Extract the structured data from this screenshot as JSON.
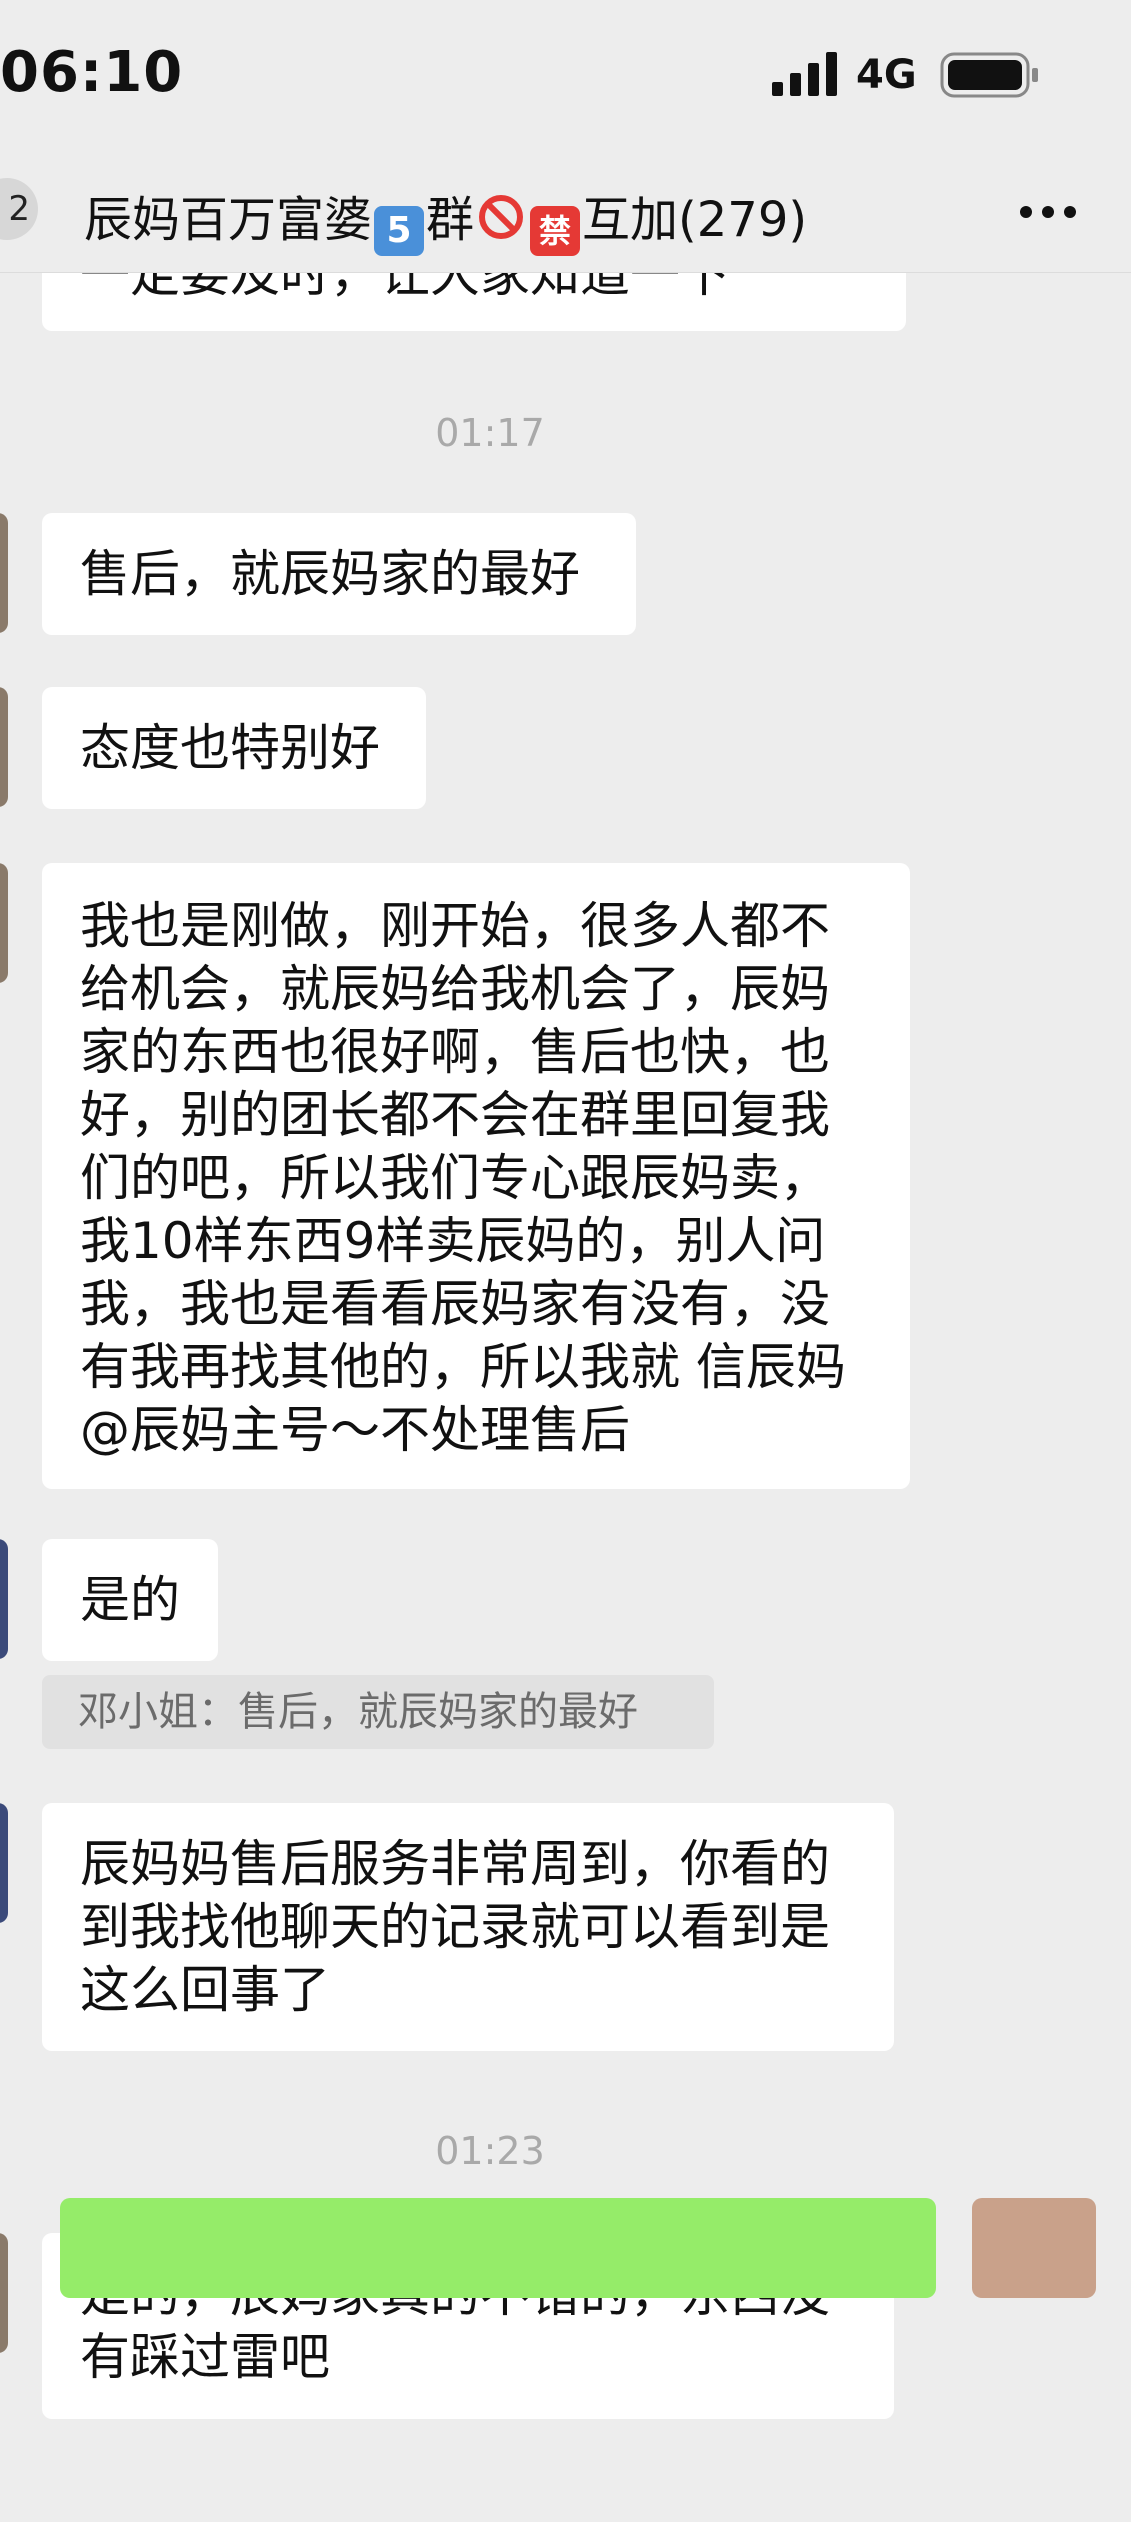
{
  "status": {
    "time": "06:10",
    "network": "4G"
  },
  "nav": {
    "back_count": "2",
    "title_prefix": "辰妈百万富婆",
    "title_badge_five": "5",
    "title_group": "群",
    "title_badge_ban": "禁",
    "title_suffix": "互加(279)"
  },
  "messages": {
    "partial_top": "一定要及时，让大家知道一下",
    "time1": "01:17",
    "m1": "售后，就辰妈家的最好",
    "m2": "态度也特别好",
    "m3_lines": [
      "我也是刚做，刚开始，很多人都不",
      "给机会，就辰妈给我机会了，辰妈",
      "家的东西也很好啊，售后也快，也",
      "好，别的团长都不会在群里回复我",
      "们的吧，所以我们专心跟辰妈卖，",
      "我10样东西9样卖辰妈的，别人问",
      "我，我也是看看辰妈家有没有，没",
      "有我再找其他的，所以我就 信辰妈",
      "@辰妈主号～不处理售后"
    ],
    "m4": "是的",
    "quote": "邓小姐：售后，就辰妈家的最好",
    "m5_lines": [
      "辰妈妈售后服务非常周到，你看的",
      "到我找他聊天的记录就可以看到是",
      "这么回事了"
    ],
    "time2": "01:23",
    "m6_lines": [
      "是的，辰妈家真的不错的，东西没",
      "有踩过雷吧"
    ]
  }
}
